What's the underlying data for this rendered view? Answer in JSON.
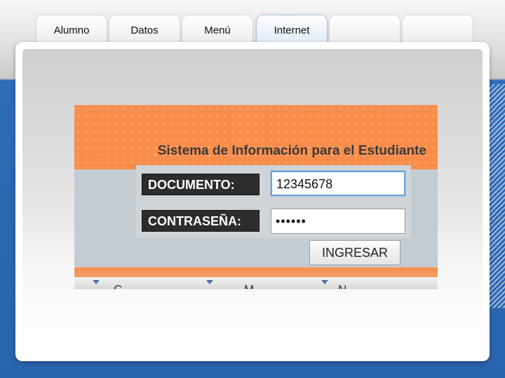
{
  "tabs": [
    {
      "label": "Alumno"
    },
    {
      "label": "Datos"
    },
    {
      "label": "Menú"
    },
    {
      "label": "Internet"
    },
    {
      "label": ""
    },
    {
      "label": ""
    }
  ],
  "login": {
    "title": "Sistema de Información para el Estudiante",
    "document_label": "DOCUMENTO:",
    "document_value": "12345678",
    "password_label": "CONTRASEÑA:",
    "password_value": "••••••",
    "submit_label": "INGRESAR"
  },
  "nav": {
    "items": [
      "C",
      "M",
      "N"
    ]
  },
  "colors": {
    "header_orange": "#f98e4c",
    "background_blue": "#2a63ad",
    "label_dark": "#2d2d2d"
  }
}
